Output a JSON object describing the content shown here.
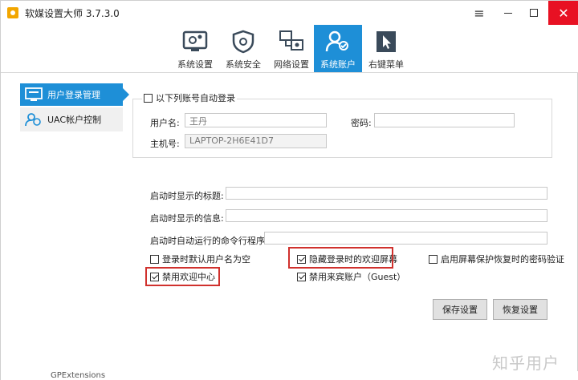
{
  "window": {
    "title": "软媒设置大师 3.7.3.0"
  },
  "tabs": [
    {
      "label": "系统设置",
      "icon": "system-settings-icon",
      "active": false
    },
    {
      "label": "系统安全",
      "icon": "shield-gear-icon",
      "active": false
    },
    {
      "label": "网络设置",
      "icon": "network-icon",
      "active": false
    },
    {
      "label": "系统账户",
      "icon": "user-account-icon",
      "active": true
    },
    {
      "label": "右键菜单",
      "icon": "cursor-icon",
      "active": false
    }
  ],
  "sidebar": {
    "items": [
      {
        "label": "用户登录管理",
        "icon": "monitor-login-icon",
        "active": true
      },
      {
        "label": "UAC帐户控制",
        "icon": "uac-users-icon",
        "active": false
      }
    ]
  },
  "autologin": {
    "checkbox_label": "以下列账号自动登录",
    "checked": false,
    "username_label": "用户名:",
    "username_value": "王丹",
    "password_label": "密码:",
    "password_value": "",
    "hostname_label": "主机号:",
    "hostname_value": "LAPTOP-2H6E41D7"
  },
  "startup": {
    "title_label": "启动时显示的标题:",
    "title_value": "",
    "message_label": "启动时显示的信息:",
    "message_value": "",
    "command_label": "启动时自动运行的命令行程序:",
    "command_value": ""
  },
  "options": [
    {
      "label": "登录时默认用户名为空",
      "checked": false
    },
    {
      "label": "隐藏登录时的欢迎屏幕",
      "checked": true
    },
    {
      "label": "启用屏幕保护恢复时的密码验证",
      "checked": false
    },
    {
      "label": "禁用欢迎中心",
      "checked": true
    },
    {
      "label": "禁用来宾账户（Guest）",
      "checked": true
    }
  ],
  "buttons": {
    "save": "保存设置",
    "restore": "恢复设置"
  },
  "watermark": "知乎用户",
  "background_fragment": "GPExtensions",
  "colors": {
    "accent": "#1e8fd7",
    "close": "#e81123",
    "highlight": "#d0312d"
  }
}
